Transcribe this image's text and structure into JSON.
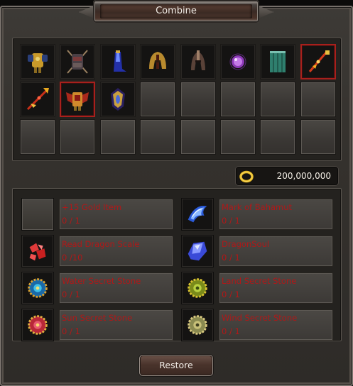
{
  "window": {
    "title": "Combine"
  },
  "inventory": {
    "slots": [
      {
        "icon": "gold-armor-icon",
        "filled": true
      },
      {
        "icon": "dark-armor-icon",
        "filled": true
      },
      {
        "icon": "blue-gem-boot-icon",
        "filled": true
      },
      {
        "icon": "gold-helmet-icon",
        "filled": true
      },
      {
        "icon": "dark-helmet-icon",
        "filled": true
      },
      {
        "icon": "purple-orb-icon",
        "filled": true
      },
      {
        "icon": "teal-cloth-icon",
        "filled": true
      },
      {
        "icon": "red-spear-icon",
        "filled": true,
        "selected": true
      },
      {
        "icon": "red-staff-icon",
        "filled": true
      },
      {
        "icon": "red-winged-armor-icon",
        "filled": true,
        "selected": true
      },
      {
        "icon": "blue-shield-icon",
        "filled": true
      },
      {
        "filled": false
      },
      {
        "filled": false
      },
      {
        "filled": false
      },
      {
        "filled": false
      },
      {
        "filled": false
      },
      {
        "filled": false
      },
      {
        "filled": false
      },
      {
        "filled": false
      },
      {
        "filled": false
      },
      {
        "filled": false
      },
      {
        "filled": false
      },
      {
        "filled": false
      },
      {
        "filled": false
      }
    ]
  },
  "gold": {
    "icon": "gold-ring-icon",
    "amount": "200,000,000"
  },
  "materials": [
    {
      "name": "+15 Gold Item",
      "count": "0 / 1",
      "icon": "",
      "empty": true
    },
    {
      "name": "Mark of Bahamut",
      "count": "0 / 1",
      "icon": "blue-claw-icon"
    },
    {
      "name": "Read Dragon Scale",
      "count": "0 /10",
      "icon": "red-scale-icon"
    },
    {
      "name": "DragonSoul",
      "count": "0 / 1",
      "icon": "blue-crystal-icon"
    },
    {
      "name": "Water Secret Stone",
      "count": "0 / 1",
      "icon": "water-stone-icon"
    },
    {
      "name": "Land Secret Stone",
      "count": "0 / 1",
      "icon": "land-stone-icon"
    },
    {
      "name": "Sun Secret Stone",
      "count": "0 / 1",
      "icon": "sun-stone-icon"
    },
    {
      "name": "Wind Secret Stone",
      "count": "0 / 1",
      "icon": "wind-stone-icon"
    }
  ],
  "buttons": {
    "restore": "Restore"
  },
  "colors": {
    "requirement_text": "#b01818",
    "selected_border": "#a8201c"
  }
}
